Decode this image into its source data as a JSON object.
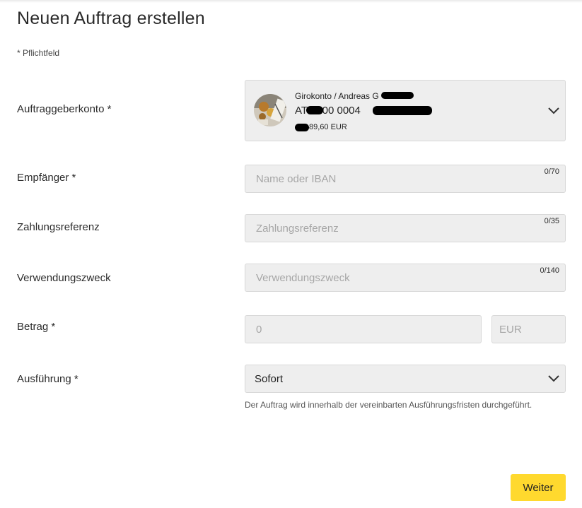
{
  "page": {
    "title": "Neuen Auftrag erstellen",
    "required_hint": "* Pflichtfeld"
  },
  "account": {
    "label": "Auftraggeberkonto *",
    "name": "Girokonto / Andreas G",
    "iban": "AT  5200 0004",
    "balance": "89,60 EUR",
    "dropdown_icon": "chevron-down-icon"
  },
  "recipient": {
    "label": "Empfänger *",
    "placeholder": "Name oder IBAN",
    "counter": "0/70"
  },
  "reference": {
    "label": "Zahlungsreferenz",
    "placeholder": "Zahlungsreferenz",
    "counter": "0/35"
  },
  "purpose": {
    "label": "Verwendungszweck",
    "placeholder": "Verwendungszweck",
    "counter": "0/140"
  },
  "amount": {
    "label": "Betrag *",
    "placeholder": "0",
    "currency": "EUR"
  },
  "execution": {
    "label": "Ausführung *",
    "value": "Sofort",
    "note": "Der Auftrag wird innerhalb der vereinbarten Ausführungsfristen durchgeführt."
  },
  "actions": {
    "next_label": "Weiter"
  },
  "colors": {
    "accent": "#ffd92e",
    "field_bg": "#eeeeee",
    "field_border": "#d8d8d8"
  }
}
